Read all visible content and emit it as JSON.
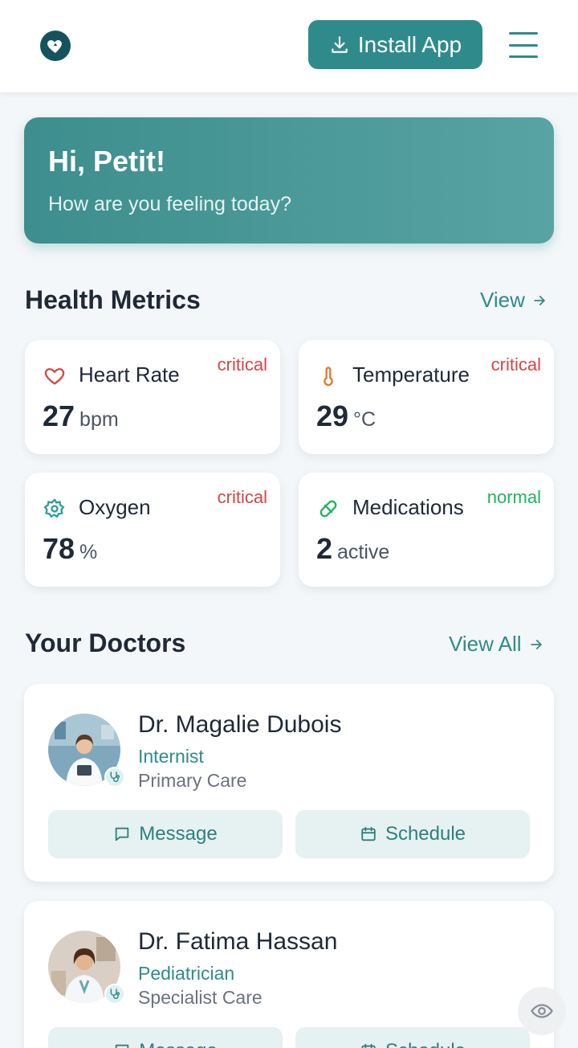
{
  "header": {
    "logo_icon": "heart-icon",
    "install_label": "Install App",
    "install_icon": "download-icon",
    "menu_icon": "hamburger-icon"
  },
  "greeting": {
    "title": "Hi, Petit!",
    "subtitle": "How are you feeling today?"
  },
  "health_metrics": {
    "title": "Health Metrics",
    "link_label": "View",
    "cards": [
      {
        "label": "Heart Rate",
        "status": "critical",
        "value": "27",
        "unit": "bpm",
        "icon": "heart-icon",
        "icon_color": "#d64545"
      },
      {
        "label": "Temperature",
        "status": "critical",
        "value": "29",
        "unit": "°C",
        "icon": "thermometer-icon",
        "icon_color": "#e07a2e"
      },
      {
        "label": "Oxygen",
        "status": "critical",
        "value": "78",
        "unit": "%",
        "icon": "oxygen-icon",
        "icon_color": "#2f9b9b"
      },
      {
        "label": "Medications",
        "status": "normal",
        "value": "2",
        "unit": "active",
        "icon": "pill-icon",
        "icon_color": "#22b35e"
      }
    ]
  },
  "doctors": {
    "title": "Your Doctors",
    "link_label": "View All",
    "list": [
      {
        "name": "Dr. Magalie Dubois",
        "specialty": "Internist",
        "care": "Primary Care",
        "message_label": "Message",
        "schedule_label": "Schedule"
      },
      {
        "name": "Dr. Fatima Hassan",
        "specialty": "Pediatrician",
        "care": "Specialist Care",
        "message_label": "Message",
        "schedule_label": "Schedule"
      }
    ]
  },
  "colors": {
    "accent": "#2f8b8b",
    "critical": "#d64545",
    "normal": "#22b35e"
  },
  "fab_icon": "eye-icon"
}
